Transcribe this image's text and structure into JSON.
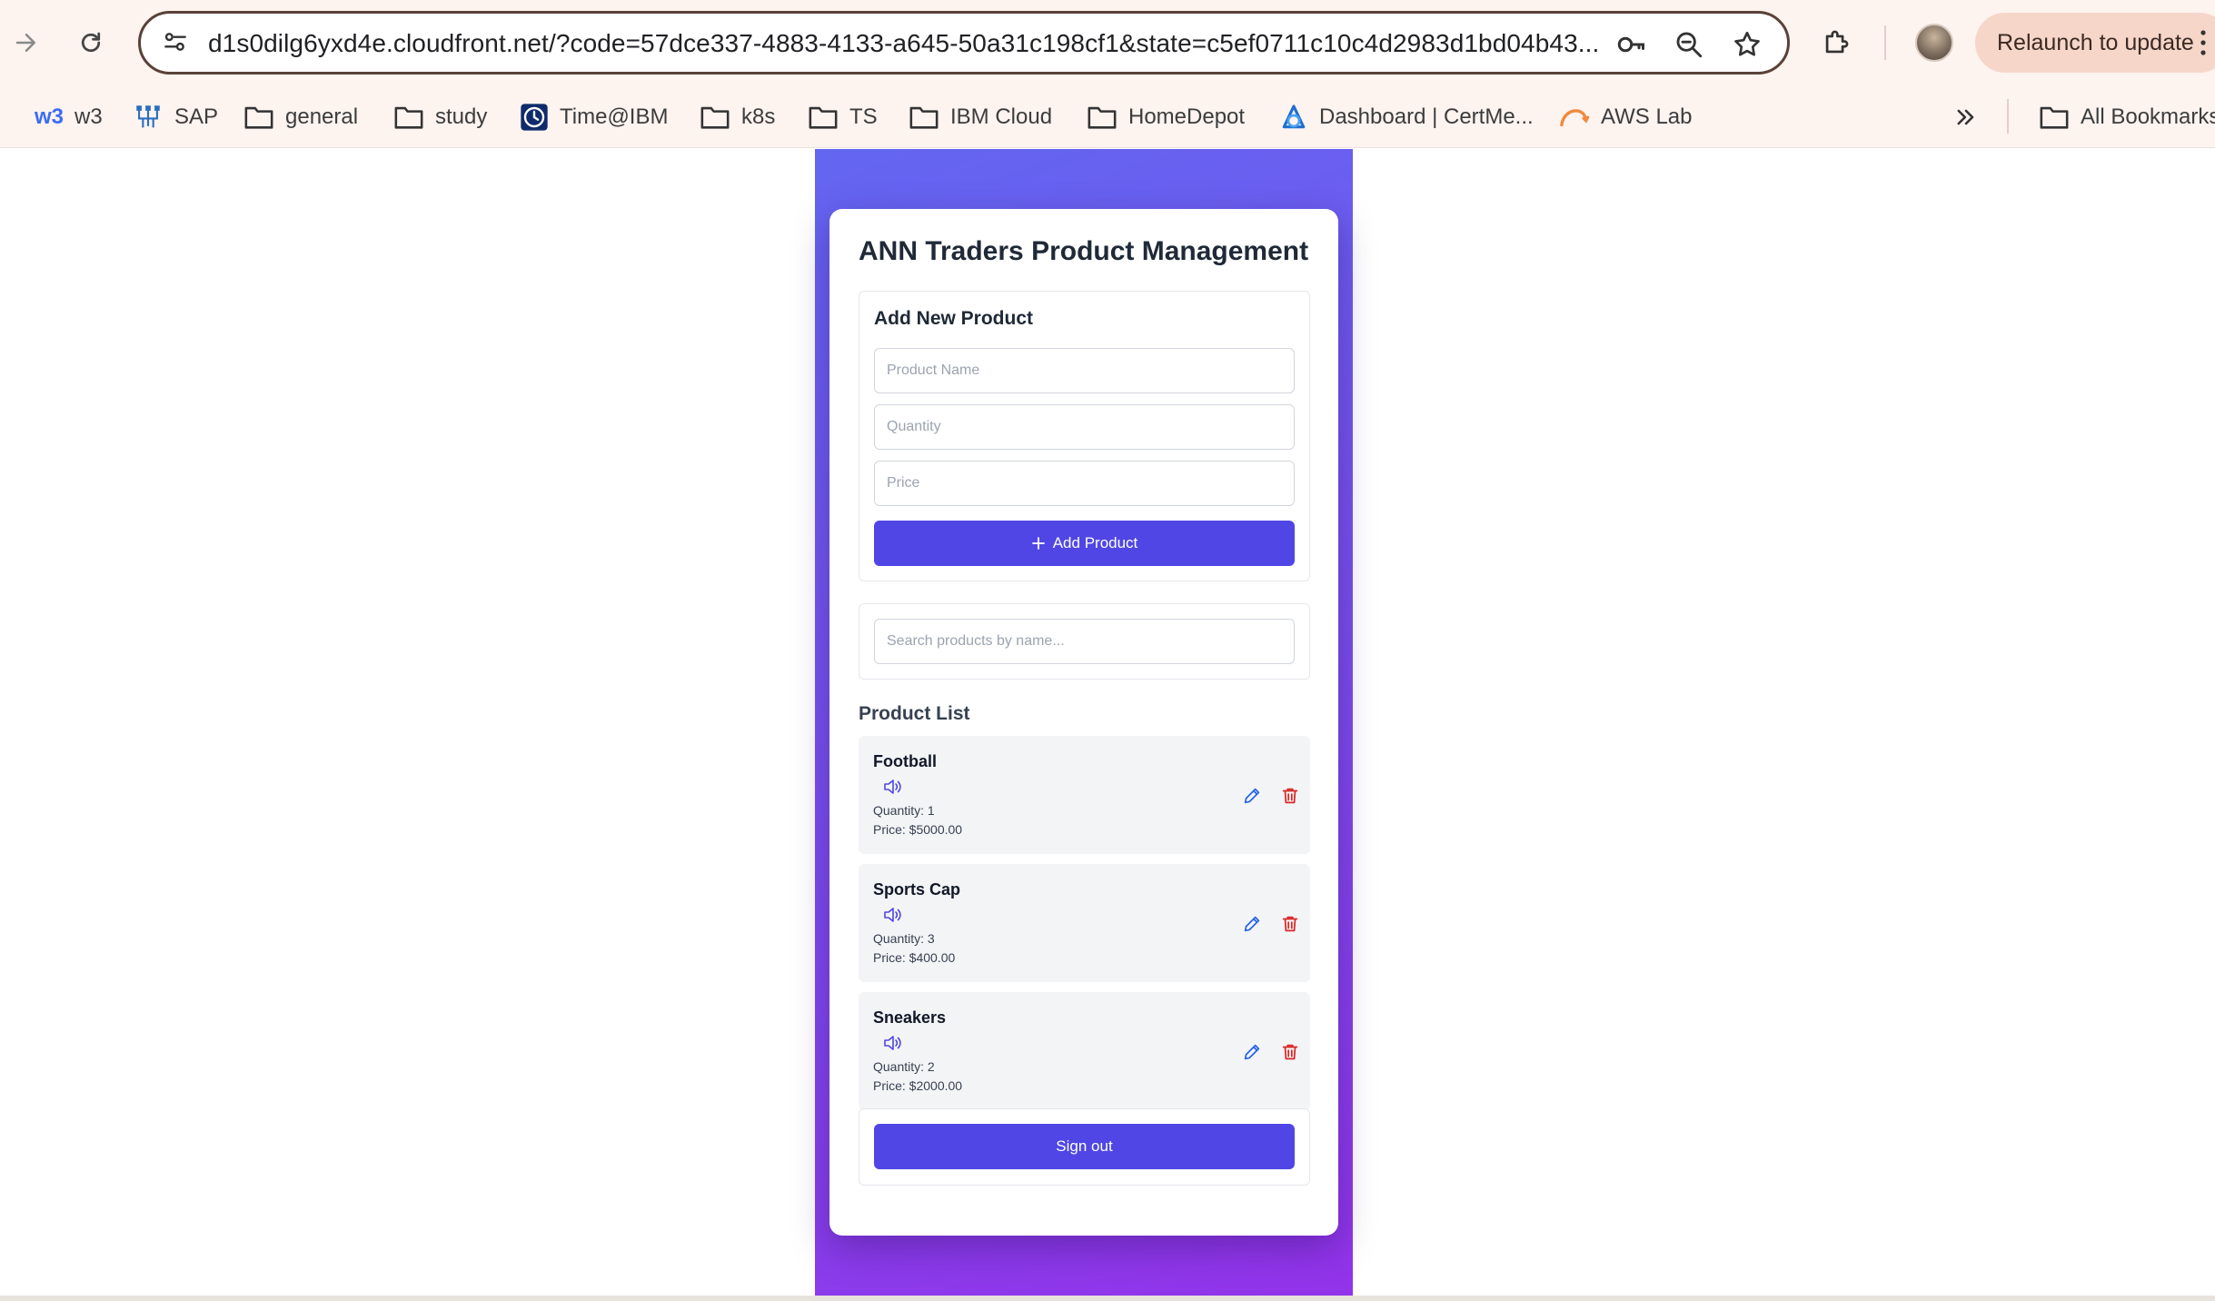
{
  "browser": {
    "url": "d1s0dilg6yxd4e.cloudfront.net/?code=57dce337-4883-4133-a645-50a31c198cf1&state=c5ef0711c10c4d2983d1bd04b43...",
    "relaunch_label": "Relaunch to update",
    "bookmarks": [
      {
        "label": "w3",
        "icon": "w3-logo-icon"
      },
      {
        "label": "SAP",
        "icon": "sap-logo-icon"
      },
      {
        "label": "general",
        "icon": "folder-icon"
      },
      {
        "label": "study",
        "icon": "folder-icon"
      },
      {
        "label": "Time@IBM",
        "icon": "clock-icon"
      },
      {
        "label": "k8s",
        "icon": "folder-icon"
      },
      {
        "label": "TS",
        "icon": "folder-icon"
      },
      {
        "label": "IBM Cloud",
        "icon": "folder-icon"
      },
      {
        "label": "HomeDepot",
        "icon": "folder-icon"
      },
      {
        "label": "Dashboard | CertMe...",
        "icon": "certme-logo-icon"
      },
      {
        "label": "AWS Lab",
        "icon": "aws-logo-icon"
      }
    ],
    "w3_badge": "w3",
    "all_bookmarks_label": "All Bookmarks"
  },
  "app": {
    "title": "ANN Traders Product Management",
    "add_form": {
      "heading": "Add New Product",
      "name_placeholder": "Product Name",
      "quantity_placeholder": "Quantity",
      "price_placeholder": "Price",
      "submit_label": "Add Product"
    },
    "search": {
      "placeholder": "Search products by name..."
    },
    "list_heading": "Product List",
    "products": [
      {
        "name": "Football",
        "quantity": "Quantity: 1",
        "price": "Price: $5000.00"
      },
      {
        "name": "Sports Cap",
        "quantity": "Quantity: 3",
        "price": "Price: $400.00"
      },
      {
        "name": "Sneakers",
        "quantity": "Quantity: 2",
        "price": "Price: $2000.00"
      }
    ],
    "signout_label": "Sign out"
  },
  "colors": {
    "primary": "#4f46e5",
    "gradient_start": "#6366f1",
    "gradient_end": "#9333ea",
    "edit_icon": "#2563eb",
    "delete_icon": "#dc2626"
  }
}
